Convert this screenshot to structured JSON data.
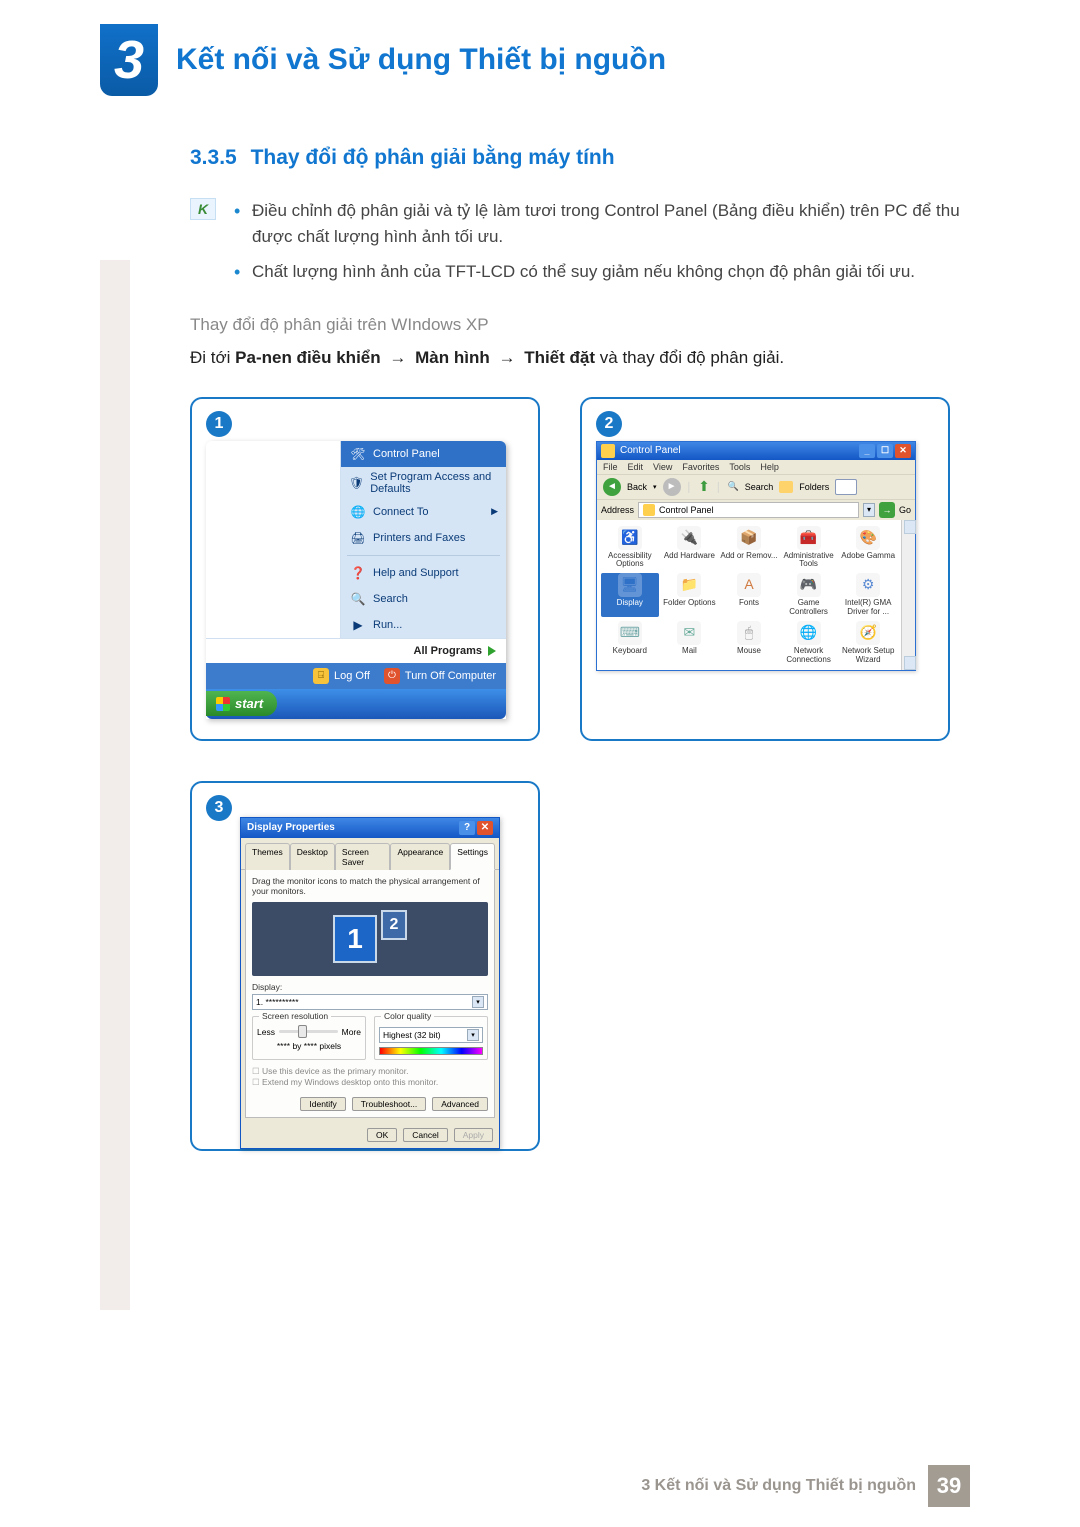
{
  "chapter": {
    "number": "3",
    "title": "Kết nối và Sử dụng Thiết bị nguồn"
  },
  "section": {
    "number": "3.3.5",
    "title": "Thay đổi độ phân giải bằng máy tính"
  },
  "notes": [
    "Điều chỉnh độ phân giải và tỷ lệ làm tươi trong Control Panel (Bảng điều khiển) trên PC để thu được chất lượng hình ảnh tối ưu.",
    "Chất lượng hình ảnh của TFT-LCD có thể suy giảm nếu không chọn độ phân giải tối ưu."
  ],
  "subheading": "Thay đổi độ phân giải trên WIndows XP",
  "instruction": {
    "prefix": "Đi tới ",
    "b1": "Pa-nen điều khiển",
    "arrow": "→",
    "b2": "Màn hình",
    "b3": "Thiết đặt",
    "suffix": " và thay đổi độ phân giải."
  },
  "step_labels": {
    "s1": "1",
    "s2": "2",
    "s3": "3"
  },
  "start_menu": {
    "right_items": [
      {
        "icon": "🛠",
        "label": "Control Panel",
        "selected": true
      },
      {
        "icon": "🛡",
        "label": "Set Program Access and Defaults"
      },
      {
        "icon": "🌐",
        "label": "Connect To",
        "submenu": true
      },
      {
        "icon": "🖨",
        "label": "Printers and Faxes"
      },
      {
        "divider": true
      },
      {
        "icon": "❓",
        "label": "Help and Support"
      },
      {
        "icon": "🔍",
        "label": "Search"
      },
      {
        "icon": "▶",
        "label": "Run..."
      }
    ],
    "all_programs": "All Programs",
    "logoff": "Log Off",
    "turnoff": "Turn Off Computer",
    "start": "start"
  },
  "control_panel": {
    "title": "Control Panel",
    "menu": [
      "File",
      "Edit",
      "View",
      "Favorites",
      "Tools",
      "Help"
    ],
    "toolbar": {
      "back": "Back",
      "search": "Search",
      "folders": "Folders"
    },
    "address_label": "Address",
    "address_value": "Control Panel",
    "go": "Go",
    "items": [
      {
        "label": "Accessibility Options",
        "color": "#3fa23f",
        "glyph": "♿"
      },
      {
        "label": "Add Hardware",
        "color": "#6b9fd8",
        "glyph": "🔌"
      },
      {
        "label": "Add or Remov...",
        "color": "#d99a3e",
        "glyph": "📦"
      },
      {
        "label": "Administrative Tools",
        "color": "#c96",
        "glyph": "🧰"
      },
      {
        "label": "Adobe Gamma",
        "color": "#c95",
        "glyph": "🎨"
      },
      {
        "label": "Display",
        "color": "#2f71c7",
        "glyph": "🖥",
        "selected": true
      },
      {
        "label": "Folder Options",
        "color": "#f0c95a",
        "glyph": "📁"
      },
      {
        "label": "Fonts",
        "color": "#d07a40",
        "glyph": "A"
      },
      {
        "label": "Game Controllers",
        "color": "#66a",
        "glyph": "🎮"
      },
      {
        "label": "Intel(R) GMA Driver for ...",
        "color": "#5b8bd4",
        "glyph": "⚙"
      },
      {
        "label": "Keyboard",
        "color": "#7aa",
        "glyph": "⌨"
      },
      {
        "label": "Mail",
        "color": "#6a9",
        "glyph": "✉"
      },
      {
        "label": "Mouse",
        "color": "#999",
        "glyph": "🖱"
      },
      {
        "label": "Network Connections",
        "color": "#3d8",
        "glyph": "🌐"
      },
      {
        "label": "Network Setup Wizard",
        "color": "#c55",
        "glyph": "🧭"
      }
    ]
  },
  "display_props": {
    "title": "Display Properties",
    "tabs": [
      "Themes",
      "Desktop",
      "Screen Saver",
      "Appearance",
      "Settings"
    ],
    "active_tab_index": 4,
    "desc": "Drag the monitor icons to match the physical arrangement of your monitors.",
    "mon1": "1",
    "mon2": "2",
    "display_label": "Display:",
    "display_value": "1. **********",
    "sr_title": "Screen resolution",
    "less": "Less",
    "more": "More",
    "res_text": "**** by **** pixels",
    "cq_title": "Color quality",
    "cq_value": "Highest (32 bit)",
    "check1": "Use this device as the primary monitor.",
    "check2": "Extend my Windows desktop onto this monitor.",
    "btn_identify": "Identify",
    "btn_troubleshoot": "Troubleshoot...",
    "btn_advanced": "Advanced",
    "btn_ok": "OK",
    "btn_cancel": "Cancel",
    "btn_apply": "Apply"
  },
  "footer": {
    "text": "3 Kết nối và Sử dụng Thiết bị nguồn",
    "page": "39"
  }
}
